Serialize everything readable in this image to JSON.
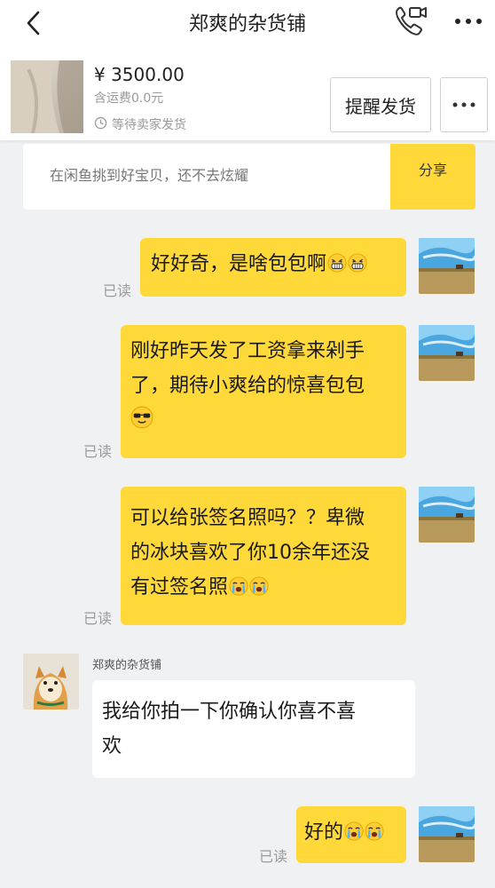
{
  "header": {
    "title": "郑爽的杂货铺"
  },
  "product": {
    "price": "¥ 3500.00",
    "shipping": "含运费0.0元",
    "status": "等待卖家发货",
    "remind_label": "提醒发货"
  },
  "share": {
    "text": "在闲鱼挑到好宝贝，还不去炫耀",
    "button": "分享"
  },
  "messages": [
    {
      "text": "好好奇，是啥包包啊",
      "read": "已读"
    },
    {
      "lines": [
        "刚好昨天发了工资拿来剁手",
        "了，期待小爽给的惊喜包包"
      ],
      "read": "已读"
    },
    {
      "lines": [
        "可以给张签名照吗？？卑微",
        "的冰块喜欢了你10余年还没",
        "有过签名照"
      ],
      "read": "已读"
    },
    {
      "sender": "郑爽的杂货铺",
      "lines": [
        "我给你拍一下你确认你喜不喜",
        "欢"
      ]
    },
    {
      "text": "好的",
      "read": "已读"
    }
  ],
  "icons": {
    "back": "chevron-left-icon",
    "call": "phone-video-icon",
    "more": "more-dots-icon",
    "clock": "clock-icon",
    "grin": "grinning-emoji",
    "cool": "sunglasses-emoji",
    "cry": "crying-emoji"
  },
  "colors": {
    "accent": "#ffd83a",
    "background": "#f0f1f3",
    "muted": "#9a9a9a"
  }
}
